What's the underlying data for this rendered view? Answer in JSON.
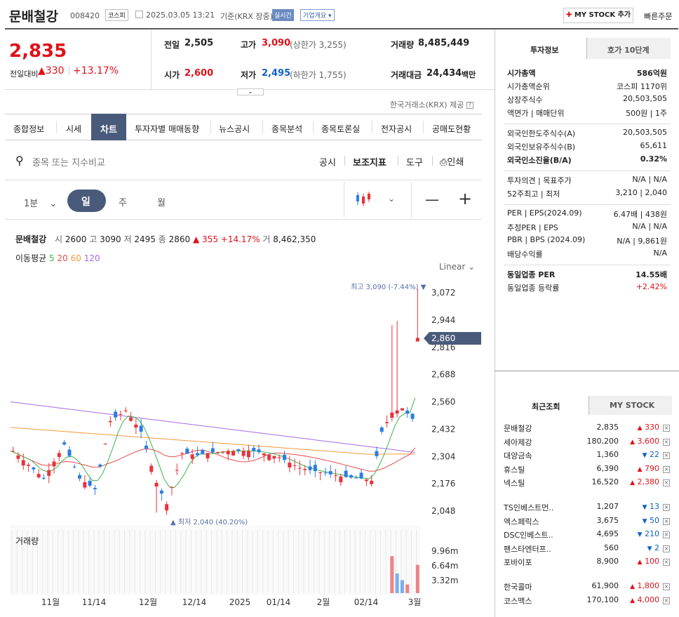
{
  "header": {
    "stock_name": "문배철강",
    "stock_code": "008420",
    "market_badge": "코스피",
    "datetime": "2025.03.05 13:21",
    "basis": "기준(KRX 장중)",
    "realtime_badge": "실시간",
    "company_overview": "기업개요",
    "my_stock_add": "MY STOCK 추가",
    "quick_order": "빠른주문"
  },
  "price": {
    "current": "2,835",
    "change_label": "전일대비",
    "change": "330",
    "change_pct": "+13.17%",
    "prev_label": "전일",
    "prev": "2,505",
    "high_label": "고가",
    "high": "3,090",
    "upper_limit": "(상한가 3,255)",
    "volume_label": "거래량",
    "volume": "8,485,449",
    "open_label": "시가",
    "open": "2,600",
    "low_label": "저가",
    "low": "2,495",
    "lower_limit": "(하한가 1,755)",
    "amount_label": "거래대금",
    "amount": "24,434",
    "amount_unit": "백만",
    "provider": "한국거래소(KRX) 제공"
  },
  "tabs": [
    "종합정보",
    "시세",
    "차트",
    "투자자별 매매동향",
    "뉴스공시",
    "종목분석",
    "종목토론실",
    "전자공시",
    "공매도현황"
  ],
  "toolbar": {
    "search_placeholder": "종목 또는 지수비교",
    "disclosure": "공시",
    "indicator": "보조지표",
    "tools": "도구",
    "print": "인쇄"
  },
  "period": {
    "minute": "1분",
    "day": "일",
    "week": "주",
    "month": "월"
  },
  "chart_info": {
    "name": "문배철강",
    "open_label": "시",
    "open": "2600",
    "high_label": "고",
    "high": "3090",
    "low_label": "저",
    "low": "2495",
    "close_label": "종",
    "close": "2860",
    "change": "▲ 355",
    "change_pct": "+14.17%",
    "volume_label": "거",
    "volume": "8,462,350",
    "ma_label": "이동평균",
    "ma5": "5",
    "ma20": "20",
    "ma60": "60",
    "ma120": "120",
    "scale": "Linear",
    "max_label": "최고 3,090 (-7.44%) ▼",
    "min_label": "▲ 최저 2,040 (40.20%)",
    "current_tag": "2,860",
    "volume_title": "거래량"
  },
  "chart_data": {
    "type": "candlestick",
    "y_ticks": [
      "3,072",
      "2,944",
      "2,816",
      "2,688",
      "2,560",
      "2,432",
      "2,304",
      "2,176",
      "2,048"
    ],
    "volume_ticks": [
      "9.96m",
      "6.64m",
      "3.32m"
    ],
    "x_ticks": [
      "11월",
      "11/14",
      "12월",
      "12/14",
      "2025",
      "01/14",
      "2월",
      "02/14",
      "3월"
    ],
    "ylim": [
      2000,
      3100
    ],
    "last_close": 2860,
    "high": 3090,
    "low": 2040,
    "colors": {
      "up": "#e8333a",
      "down": "#2a7de1",
      "ma5": "#3cb44b",
      "ma20": "#e84a4a",
      "ma60": "#f39a3c",
      "ma120": "#a56be6"
    }
  },
  "info_panel": {
    "tab_invest": "투자정보",
    "tab_orderbook": "호가 10단계",
    "rows_1": [
      {
        "label": "시가총액",
        "value": "586억원"
      },
      {
        "label": "시가총액순위",
        "value": "코스피 1170위"
      },
      {
        "label": "상장주식수",
        "value": "20,503,505"
      },
      {
        "label": "액면가 | 매매단위",
        "value": "500원 | 1주"
      }
    ],
    "rows_2": [
      {
        "label": "외국인한도주식수(A)",
        "value": "20,503,505"
      },
      {
        "label": "외국인보유주식수(B)",
        "value": "65,611"
      },
      {
        "label": "외국인소진율(B/A)",
        "value": "0.32%"
      }
    ],
    "rows_3": [
      {
        "label": "투자의견 | 목표주가",
        "value": "N/A | N/A"
      },
      {
        "label": "52주최고 | 최저",
        "value": "3,210 | 2,040"
      }
    ],
    "rows_4": [
      {
        "label": "PER | EPS(2024.09)",
        "value": "6.47배 | 438원"
      },
      {
        "label": "추정PER | EPS",
        "value": "N/A | N/A"
      },
      {
        "label": "PBR | BPS (2024.09)",
        "value": "N/A | 9,861원"
      },
      {
        "label": "배당수익률",
        "value": "N/A"
      }
    ],
    "rows_5": [
      {
        "label": "동일업종 PER",
        "value": "14.55배"
      },
      {
        "label": "동일업종 등락률",
        "value": "+2.42%"
      }
    ]
  },
  "recent": {
    "tab_recent": "최근조회",
    "tab_mystock": "MY STOCK",
    "items": [
      {
        "name": "문배철강",
        "price": "2,835",
        "dir": "up",
        "change": "330"
      },
      {
        "name": "세아제강",
        "price": "180,200",
        "dir": "up",
        "change": "3,600"
      },
      {
        "name": "대양금속",
        "price": "1,360",
        "dir": "down",
        "change": "22"
      },
      {
        "name": "휴스틸",
        "price": "6,390",
        "dir": "up",
        "change": "790"
      },
      {
        "name": "넥스틸",
        "price": "16,520",
        "dir": "up",
        "change": "2,380"
      },
      {
        "name": "TS인베스트먼..",
        "price": "1,207",
        "dir": "down",
        "change": "13"
      },
      {
        "name": "엑스페릭스",
        "price": "3,675",
        "dir": "down",
        "change": "50"
      },
      {
        "name": "DSC인베스트..",
        "price": "4,695",
        "dir": "down",
        "change": "210"
      },
      {
        "name": "팬스타엔터프..",
        "price": "560",
        "dir": "down",
        "change": "2"
      },
      {
        "name": "포바이포",
        "price": "8,900",
        "dir": "up",
        "change": "100"
      },
      {
        "name": "한국콜마",
        "price": "61,900",
        "dir": "up",
        "change": "1,800"
      },
      {
        "name": "코스맥스",
        "price": "170,100",
        "dir": "up",
        "change": "4,000"
      }
    ]
  }
}
